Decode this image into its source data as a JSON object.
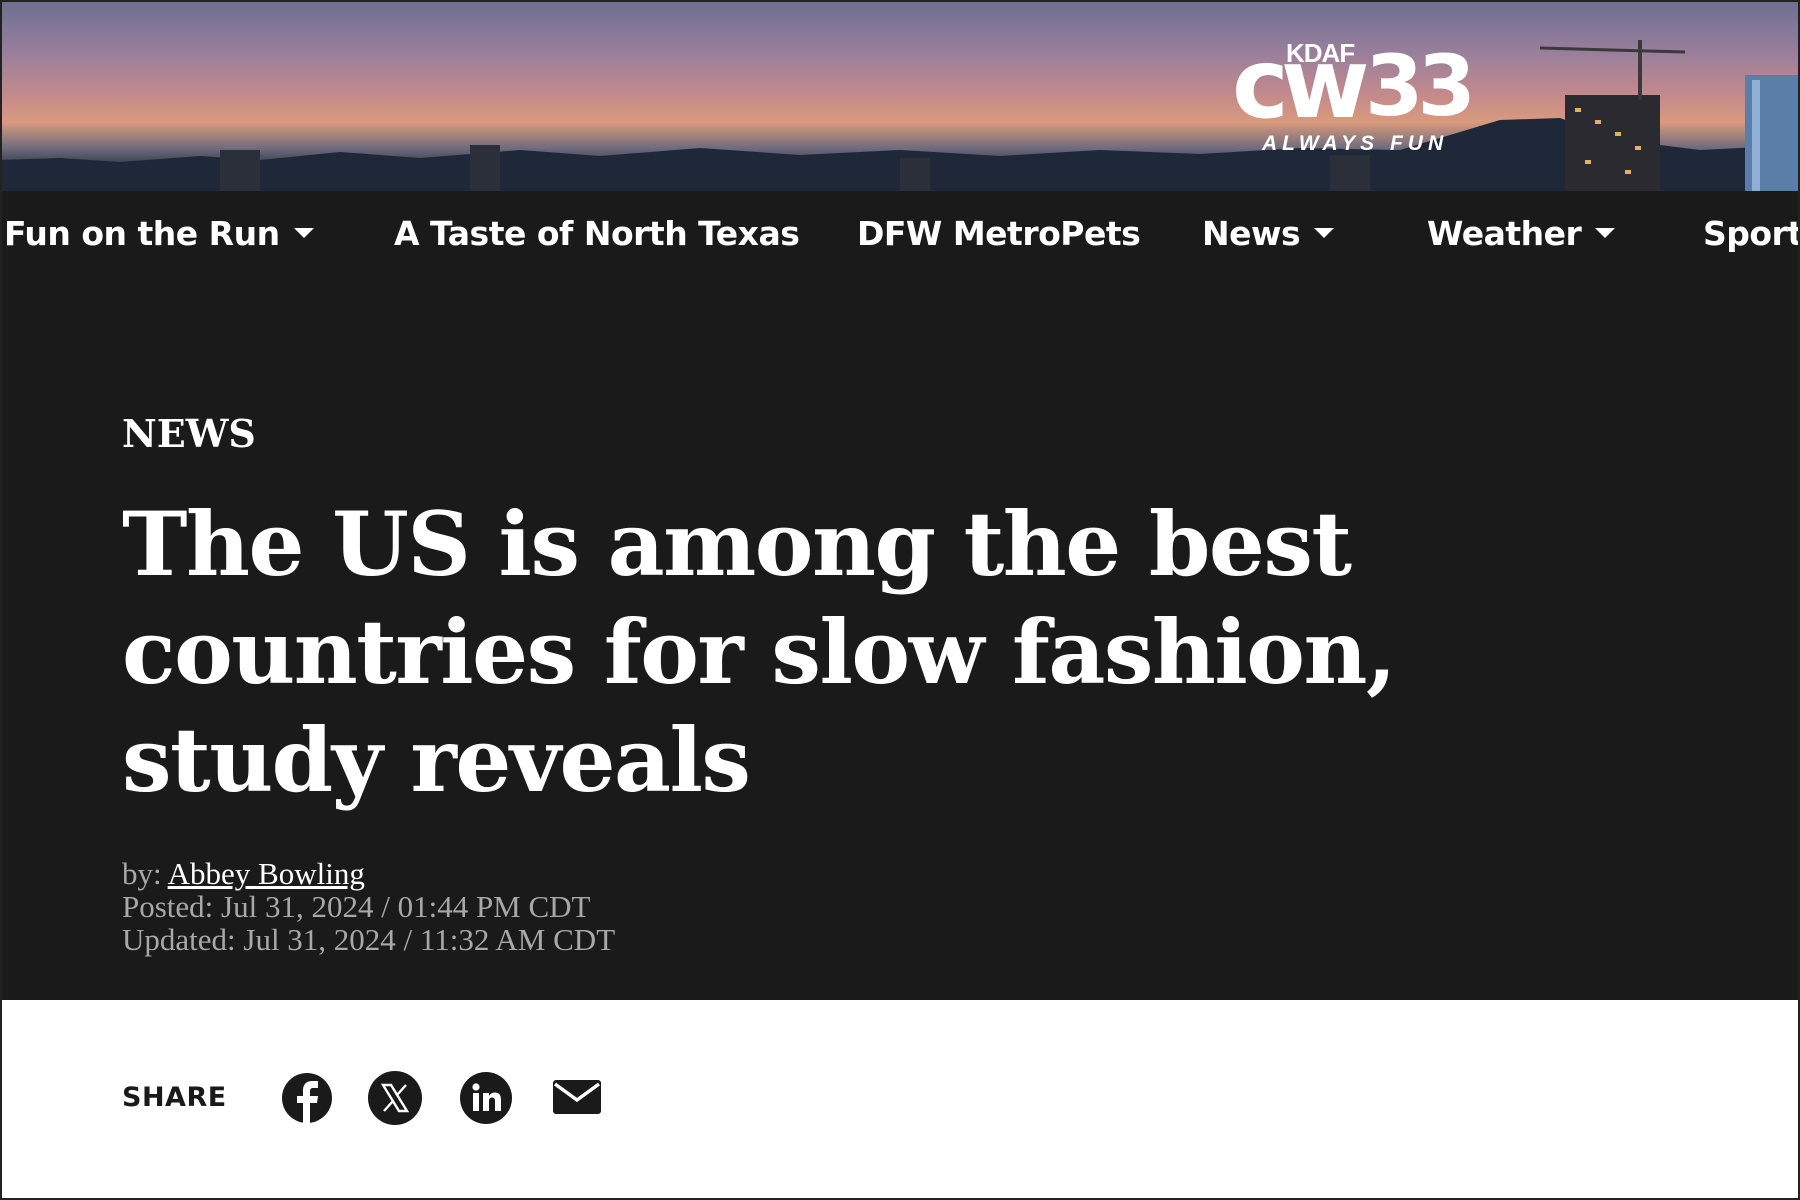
{
  "banner": {
    "logo": {
      "top_text": "KDAF",
      "main_text": "cw",
      "number": "33",
      "tagline": "ALWAYS FUN"
    }
  },
  "nav": {
    "items": [
      {
        "label": "Fun on the Run",
        "has_dropdown": true
      },
      {
        "label": "A Taste of North Texas",
        "has_dropdown": false
      },
      {
        "label": "DFW MetroPets",
        "has_dropdown": false
      },
      {
        "label": "News",
        "has_dropdown": true
      },
      {
        "label": "Weather",
        "has_dropdown": true
      },
      {
        "label": "Sport",
        "has_dropdown": false
      }
    ]
  },
  "article": {
    "category": "NEWS",
    "headline": "The US is among the best countries for slow fashion, study reveals",
    "byline_prefix": "by: ",
    "author": "Abbey Bowling",
    "posted": "Posted: Jul 31, 2024 / 01:44 PM CDT",
    "updated": "Updated: Jul 31, 2024 / 11:32 AM CDT"
  },
  "share": {
    "label": "SHARE",
    "icons": [
      "facebook-icon",
      "x-icon",
      "linkedin-icon",
      "email-icon"
    ]
  },
  "colors": {
    "nav_bg": "#1a1a1a",
    "hero_bg": "#1a1a1a",
    "text_light": "#ffffff",
    "meta_text": "#a8a8a8"
  }
}
